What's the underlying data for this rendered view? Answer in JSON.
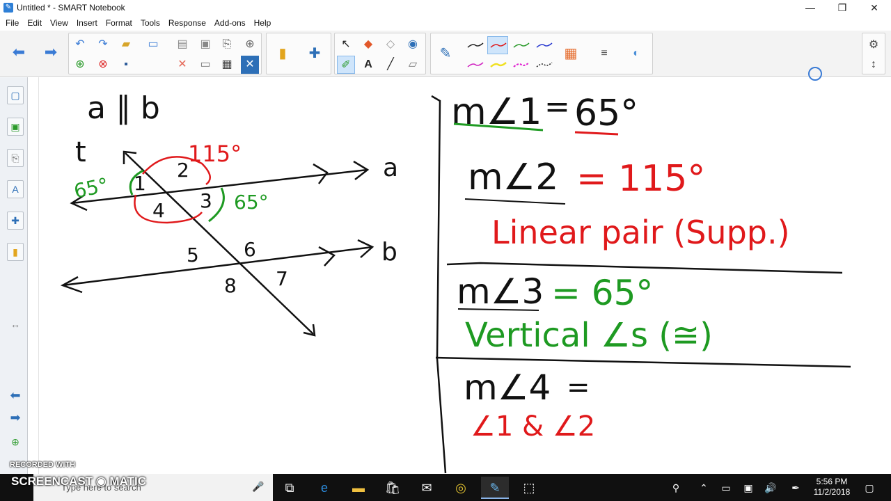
{
  "window": {
    "title": "Untitled * - SMART Notebook",
    "minimize": "—",
    "restore": "❐",
    "close": "✕"
  },
  "menu": {
    "items": [
      "File",
      "Edit",
      "View",
      "Insert",
      "Format",
      "Tools",
      "Response",
      "Add-ons",
      "Help"
    ]
  },
  "canvas": {
    "notes_left": {
      "given": "a ∥ b",
      "transversal": "t",
      "line_a": "a",
      "line_b": "b",
      "angle_labels": [
        "1",
        "2",
        "3",
        "4",
        "5",
        "6",
        "7",
        "8"
      ],
      "measure_115": "115°",
      "measure_65_left": "65°",
      "measure_65_right": "65°"
    },
    "notes_right": {
      "row1_left": "m∠1",
      "row1_eq": "=",
      "row1_value": "65°",
      "row2_left": "m∠2",
      "row2_value": "= 115°",
      "row2_reason": "Linear pair (Supp.)",
      "row3_left": "m∠3",
      "row3_value": "= 65°",
      "row3_reason": "Vertical ∠s (≅)",
      "row4_left": "m∠4",
      "row4_eq": "=",
      "row4_note": "∠1 & ∠2"
    },
    "colors": {
      "ink_black": "#111111",
      "ink_red": "#e0191b",
      "ink_green": "#1e9a22"
    }
  },
  "watermark": {
    "recorded_with": "RECORDED WITH",
    "brand": "SCREENCAST ◉ MATIC"
  },
  "taskbar": {
    "search_placeholder": "Type here to search",
    "time": "5:56 PM",
    "date": "11/2/2018"
  }
}
